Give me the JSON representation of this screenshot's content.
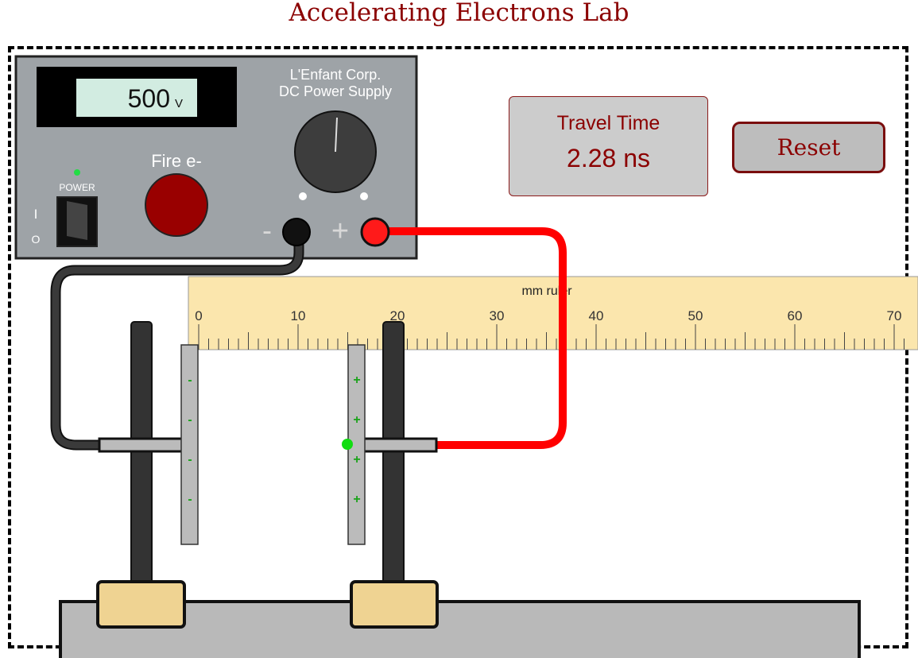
{
  "page": {
    "title": "Accelerating Electrons Lab"
  },
  "power_supply": {
    "brand_line1": "L'Enfant Corp.",
    "brand_line2": "DC Power Supply",
    "voltage_value": "500",
    "voltage_unit": "V",
    "fire_label": "Fire e-",
    "power_label": "POWER",
    "switch_on_label": "I",
    "switch_off_label": "O",
    "negative_terminal_label": "-",
    "positive_terminal_label": "+"
  },
  "readout": {
    "label": "Travel Time",
    "value": "2.28 ns"
  },
  "controls": {
    "reset_label": "Reset"
  },
  "ruler": {
    "title": "mm ruler",
    "ticks": [
      "0",
      "10",
      "20",
      "30",
      "40",
      "50",
      "60",
      "70"
    ]
  },
  "plates": {
    "left_signs": [
      "-",
      "-",
      "-",
      "-"
    ],
    "right_signs": [
      "+",
      "+",
      "+",
      "+"
    ]
  },
  "colors": {
    "accent": "#8b0000",
    "wire_negative": "#333333",
    "wire_positive": "#ff0000",
    "panel": "#9ea3a7",
    "lcd": "#d2ece1",
    "ruler": "#fbe6ad",
    "power_led": "#22dd44",
    "electron": "#11dd11"
  }
}
